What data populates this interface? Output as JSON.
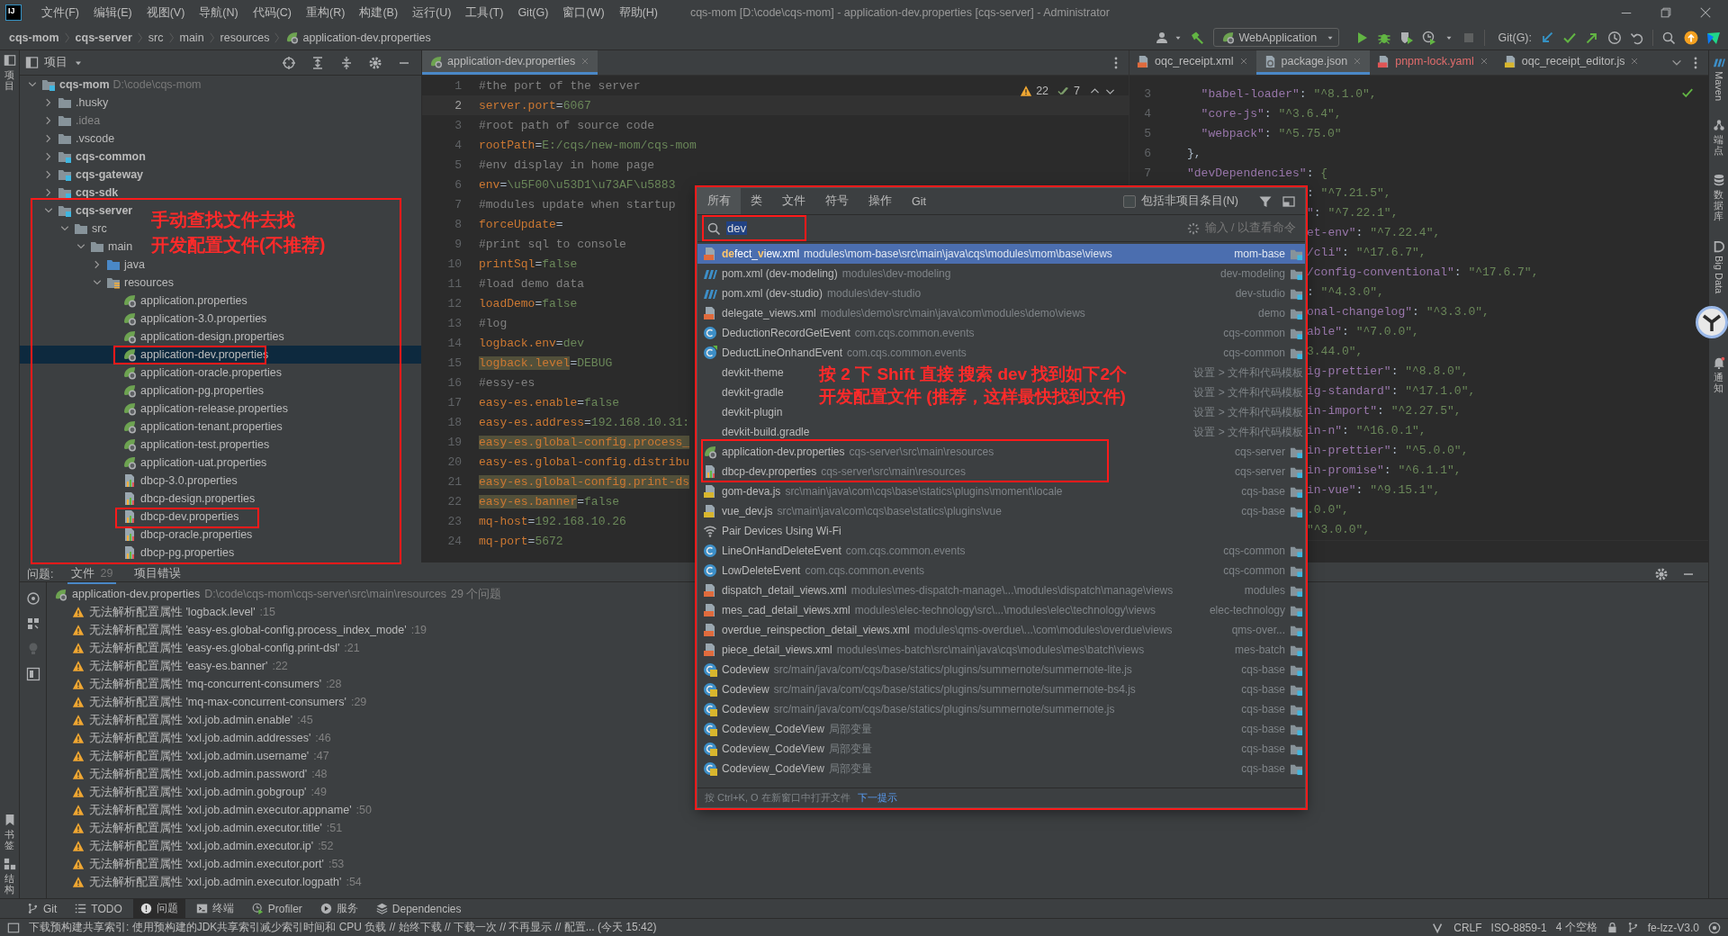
{
  "window": {
    "logo": "IJ",
    "title": "cqs-mom [D:\\code\\cqs-mom] - application-dev.properties [cqs-server] - Administrator"
  },
  "menu": [
    "文件(F)",
    "编辑(E)",
    "视图(V)",
    "导航(N)",
    "代码(C)",
    "重构(R)",
    "构建(B)",
    "运行(U)",
    "工具(T)",
    "Git(G)",
    "窗口(W)",
    "帮助(H)"
  ],
  "breadcrumbs": [
    {
      "label": "cqs-mom",
      "bold": true
    },
    {
      "label": "cqs-server",
      "bold": true
    },
    {
      "label": "src",
      "bold": false
    },
    {
      "label": "main",
      "bold": false
    },
    {
      "label": "resources",
      "bold": false
    },
    {
      "label": "application-dev.properties",
      "bold": false
    }
  ],
  "toolbar": {
    "run_config": "WebApplication",
    "git_label": "Git(G):"
  },
  "left_strip": {
    "top": [
      {
        "label": "项目"
      }
    ],
    "bottom": [
      {
        "label": "书签"
      },
      {
        "label": "结构"
      }
    ]
  },
  "right_strip": [
    {
      "label": "Maven",
      "vertical_latin": true
    },
    {
      "label": "端点",
      "vertical_latin": false
    },
    {
      "label": "数据库",
      "vertical_latin": false
    },
    {
      "label": "Big Data",
      "vertical_latin": true
    },
    {
      "label": "通知",
      "vertical_latin": false
    }
  ],
  "project": {
    "title": "项目",
    "tree": [
      {
        "label": "cqs-mom",
        "path": "D:\\code\\cqs-mom",
        "kind": "module",
        "selected": false,
        "expanded": true,
        "children": [
          {
            "label": ".husky",
            "kind": "folder",
            "selected": false,
            "expanded": false
          },
          {
            "label": ".idea",
            "kind": "excluded",
            "selected": false,
            "expanded": false
          },
          {
            "label": ".vscode",
            "kind": "folder",
            "selected": false,
            "expanded": false
          },
          {
            "label": "cqs-common",
            "kind": "module",
            "selected": false,
            "expanded": false
          },
          {
            "label": "cqs-gateway",
            "kind": "module",
            "selected": false,
            "expanded": false
          },
          {
            "label": "cqs-sdk",
            "kind": "module",
            "selected": false,
            "expanded": false
          },
          {
            "label": "cqs-server",
            "kind": "module",
            "selected": false,
            "expanded": true,
            "children": [
              {
                "label": "src",
                "kind": "folder",
                "selected": false,
                "expanded": true,
                "children": [
                  {
                    "label": "main",
                    "kind": "folder",
                    "selected": false,
                    "expanded": true,
                    "children": [
                      {
                        "label": "java",
                        "kind": "source",
                        "selected": false,
                        "expanded": false
                      },
                      {
                        "label": "resources",
                        "kind": "resources",
                        "selected": false,
                        "expanded": true,
                        "children": [
                          {
                            "label": "application.properties",
                            "kind": "spring",
                            "selected": false
                          },
                          {
                            "label": "application-3.0.properties",
                            "kind": "spring",
                            "selected": false
                          },
                          {
                            "label": "application-design.properties",
                            "kind": "spring",
                            "selected": false
                          },
                          {
                            "label": "application-dev.properties",
                            "kind": "spring",
                            "selected": true
                          },
                          {
                            "label": "application-oracle.properties",
                            "kind": "spring",
                            "selected": false
                          },
                          {
                            "label": "application-pg.properties",
                            "kind": "spring",
                            "selected": false
                          },
                          {
                            "label": "application-release.properties",
                            "kind": "spring",
                            "selected": false
                          },
                          {
                            "label": "application-tenant.properties",
                            "kind": "spring",
                            "selected": false
                          },
                          {
                            "label": "application-test.properties",
                            "kind": "spring",
                            "selected": false
                          },
                          {
                            "label": "application-uat.properties",
                            "kind": "spring",
                            "selected": false
                          },
                          {
                            "label": "dbcp-3.0.properties",
                            "kind": "dbcp",
                            "selected": false
                          },
                          {
                            "label": "dbcp-design.properties",
                            "kind": "dbcp",
                            "selected": false
                          },
                          {
                            "label": "dbcp-dev.properties",
                            "kind": "dbcp",
                            "selected": false
                          },
                          {
                            "label": "dbcp-oracle.properties",
                            "kind": "dbcp",
                            "selected": false
                          },
                          {
                            "label": "dbcp-pg.properties",
                            "kind": "dbcp",
                            "selected": false
                          }
                        ]
                      }
                    ]
                  }
                ]
              }
            ]
          }
        ]
      }
    ]
  },
  "editor": {
    "tab": {
      "label": "application-dev.properties",
      "selected": true
    },
    "warnings": "22",
    "weak_warnings": "7",
    "lines": [
      {
        "number": "1",
        "kind": "comment",
        "text": "#the port of the server",
        "current": false
      },
      {
        "number": "2",
        "kind": "property",
        "text": "server.port=6067",
        "current": true,
        "warn": false
      },
      {
        "number": "3",
        "kind": "comment",
        "text": "#root path of source code",
        "current": false
      },
      {
        "number": "4",
        "kind": "property",
        "text": "rootPath=E:/cqs/new-mom/cqs-mom",
        "current": false,
        "warn": false
      },
      {
        "number": "5",
        "kind": "comment",
        "text": "#env display in home page",
        "current": false
      },
      {
        "number": "6",
        "kind": "property",
        "text": "env=\\u5F00\\u53D1\\u73AF\\u5883",
        "current": false,
        "warn": false
      },
      {
        "number": "7",
        "kind": "comment",
        "text": "#modules update when startup",
        "current": false
      },
      {
        "number": "8",
        "kind": "property",
        "text": "forceUpdate=",
        "current": false,
        "warn": false
      },
      {
        "number": "9",
        "kind": "comment",
        "text": "#print sql to console",
        "current": false
      },
      {
        "number": "10",
        "kind": "property",
        "text": "printSql=false",
        "current": false,
        "warn": false
      },
      {
        "number": "11",
        "kind": "comment",
        "text": "#load demo data",
        "current": false
      },
      {
        "number": "12",
        "kind": "property",
        "text": "loadDemo=false",
        "current": false,
        "warn": false
      },
      {
        "number": "13",
        "kind": "comment",
        "text": "#log",
        "current": false
      },
      {
        "number": "14",
        "kind": "property",
        "text": "logback.env=dev",
        "current": false,
        "warn": false
      },
      {
        "number": "15",
        "kind": "property",
        "text": "logback.level=DEBUG",
        "current": false,
        "warn": true
      },
      {
        "number": "16",
        "kind": "comment",
        "text": "#essy-es",
        "current": false
      },
      {
        "number": "17",
        "kind": "property",
        "text": "easy-es.enable=false",
        "current": false,
        "warn": false
      },
      {
        "number": "18",
        "kind": "property",
        "text": "easy-es.address=192.168.10.31:",
        "current": false,
        "warn": false
      },
      {
        "number": "19",
        "kind": "property",
        "text": "easy-es.global-config.process_",
        "current": false,
        "warn": true
      },
      {
        "number": "20",
        "kind": "property",
        "text": "easy-es.global-config.distribu",
        "current": false,
        "warn": false
      },
      {
        "number": "21",
        "kind": "property",
        "text": "easy-es.global-config.print-ds",
        "current": false,
        "warn": true
      },
      {
        "number": "22",
        "kind": "property",
        "text": "easy-es.banner=false",
        "current": false,
        "warn": true
      },
      {
        "number": "23",
        "kind": "property",
        "text": "mq-host=192.168.10.26",
        "current": false,
        "warn": false
      },
      {
        "number": "24",
        "kind": "property",
        "text": "mq-port=5672",
        "current": false,
        "warn": false
      }
    ]
  },
  "right_editor": {
    "tabs": [
      {
        "label": "oqc_receipt.xml",
        "kind": "xml",
        "selected": false,
        "error": false
      },
      {
        "label": "package.json",
        "kind": "json",
        "selected": true,
        "error": false
      },
      {
        "label": "pnpm-lock.yaml",
        "kind": "yml",
        "selected": false,
        "error": true
      },
      {
        "label": "oqc_receipt_editor.js",
        "kind": "js",
        "selected": false,
        "error": false
      }
    ],
    "lines": [
      {
        "number": "3",
        "text": "  \"babel-loader\": \"^8.1.0\","
      },
      {
        "number": "4",
        "text": "  \"core-js\": \"^3.6.4\","
      },
      {
        "number": "5",
        "text": "  \"webpack\": \"^5.75.0\""
      },
      {
        "number": "6",
        "text": "},"
      },
      {
        "number": "7",
        "text": "\"devDependencies\": {"
      },
      {
        "text": ": \"^7.21.5\","
      },
      {
        "text": "\": \"^7.22.1\","
      },
      {
        "text": "et-env\": \"^7.22.4\","
      },
      {
        "text": "/cli\": \"^17.6.7\","
      },
      {
        "text": "/config-conventional\": \"^17.6.7\","
      },
      {
        "text": ": \"^4.3.0\","
      },
      {
        "text": "onal-changelog\": \"^3.3.0\","
      },
      {
        "text": "able\": \"^7.0.0\","
      },
      {
        "text": "3.44.0\","
      },
      {
        "text": "ig-prettier\": \"^8.8.0\","
      },
      {
        "text": "ig-standard\": \"^17.1.0\","
      },
      {
        "text": "in-import\": \"^2.27.5\","
      },
      {
        "text": "in-n\": \"^16.0.1\","
      },
      {
        "text": "in-prettier\": \"^5.0.0\","
      },
      {
        "text": "in-promise\": \"^6.1.1\","
      },
      {
        "text": "in-vue\": \"^9.15.1\","
      },
      {
        "text": ".0.0\","
      },
      {
        "text": "\"^3.0.0\","
      }
    ]
  },
  "popup": {
    "tabs": [
      {
        "label": "所有",
        "selected": true
      },
      {
        "label": "类",
        "selected": false
      },
      {
        "label": "文件",
        "selected": false
      },
      {
        "label": "符号",
        "selected": false
      },
      {
        "label": "操作",
        "selected": false
      },
      {
        "label": "Git",
        "selected": false
      }
    ],
    "include_checkbox": {
      "label": "包括非项目条目(N)",
      "checked": false
    },
    "search": {
      "value": "dev"
    },
    "hint": "输入 / 以查看命令",
    "results": [
      {
        "kind": "xml",
        "name_parts": [
          {
            "text": "de",
            "match": true
          },
          {
            "text": "fect_",
            "match": false
          },
          {
            "text": "v",
            "match": true
          },
          {
            "text": "iew.xml",
            "match": false
          }
        ],
        "path": "modules\\mom-base\\src\\main\\java\\cqs\\modules\\mom\\base\\views",
        "module": "mom-base",
        "selected": true
      },
      {
        "kind": "pom",
        "name": "pom.xml (dev-modeling)",
        "path": "modules\\dev-modeling",
        "module": "dev-modeling",
        "selected": false
      },
      {
        "kind": "pom",
        "name": "pom.xml (dev-studio)",
        "path": "modules\\dev-studio",
        "module": "dev-studio",
        "selected": false
      },
      {
        "kind": "xml",
        "name": "delegate_views.xml",
        "path": "modules\\demo\\src\\main\\java\\com\\modules\\demo\\views",
        "module": "demo",
        "selected": false
      },
      {
        "kind": "class",
        "name": "DeductionRecordGetEvent",
        "path": "com.cqs.common.events",
        "module": "cqs-common",
        "selected": false
      },
      {
        "kind": "class-marked",
        "name": "DeductLineOnhandEvent",
        "path": "com.cqs.common.events",
        "module": "cqs-common",
        "selected": false
      },
      {
        "kind": "setting",
        "name": "devkit-theme",
        "location": "设置 > 文件和代码模板",
        "selected": false
      },
      {
        "kind": "setting",
        "name": "devkit-gradle",
        "location": "设置 > 文件和代码模板",
        "selected": false
      },
      {
        "kind": "setting",
        "name": "devkit-plugin",
        "location": "设置 > 文件和代码模板",
        "selected": false
      },
      {
        "kind": "setting",
        "name": "devkit-build.gradle",
        "location": "设置 > 文件和代码模板",
        "selected": false
      },
      {
        "kind": "spring",
        "name": "application-dev.properties",
        "path": "cqs-server\\src\\main\\resources",
        "module": "cqs-server",
        "selected": false
      },
      {
        "kind": "dbcp",
        "name": "dbcp-dev.properties",
        "path": "cqs-server\\src\\main\\resources",
        "module": "cqs-server",
        "selected": false
      },
      {
        "kind": "js",
        "name": "gom-deva.js",
        "path": "src\\main\\java\\com\\cqs\\base\\statics\\plugins\\moment\\locale",
        "module": "cqs-base",
        "selected": false
      },
      {
        "kind": "js",
        "name": "vue_dev.js",
        "path": "src\\main\\java\\com\\cqs\\base\\statics\\plugins\\vue",
        "module": "cqs-base",
        "selected": false
      },
      {
        "kind": "action",
        "name": "Pair Devices Using Wi-Fi",
        "selected": false
      },
      {
        "kind": "class",
        "name": "LineOnHandDeleteEvent",
        "path": "com.cqs.common.events",
        "module": "cqs-common",
        "selected": false
      },
      {
        "kind": "class",
        "name": "LowDeleteEvent",
        "path": "com.cqs.common.events",
        "module": "cqs-common",
        "selected": false
      },
      {
        "kind": "xml",
        "name": "dispatch_detail_views.xml",
        "path": "modules\\mes-dispatch-manage\\...\\modules\\dispatch\\manage\\views",
        "module": "modules",
        "selected": false
      },
      {
        "kind": "xml",
        "name": "mes_cad_detail_views.xml",
        "path": "modules\\elec-technology\\src\\...\\modules\\elec\\technology\\views",
        "module": "elec-technology",
        "selected": false
      },
      {
        "kind": "xml",
        "name": "overdue_reinspection_detail_views.xml",
        "path": "modules\\qms-overdue\\...\\com\\modules\\overdue\\views",
        "module": "qms-over...",
        "selected": false
      },
      {
        "kind": "xml",
        "name": "piece_detail_views.xml",
        "path": "modules\\mes-batch\\src\\main\\java\\cqs\\modules\\mes\\batch\\views",
        "module": "mes-batch",
        "selected": false
      },
      {
        "kind": "js-class",
        "name": "Codeview",
        "path": "src/main/java/com/cqs/base/statics/plugins/summernote/summernote-lite.js",
        "module": "cqs-base",
        "selected": false
      },
      {
        "kind": "js-class",
        "name": "Codeview",
        "path": "src/main/java/com/cqs/base/statics/plugins/summernote/summernote-bs4.js",
        "module": "cqs-base",
        "selected": false
      },
      {
        "kind": "js-class",
        "name": "Codeview",
        "path": "src/main/java/com/cqs/base/statics/plugins/summernote/summernote.js",
        "module": "cqs-base",
        "selected": false
      },
      {
        "kind": "js-class",
        "name": "Codeview_CodeView",
        "path": "局部变量",
        "module": "cqs-base",
        "selected": false
      },
      {
        "kind": "js-class",
        "name": "Codeview_CodeView",
        "path": "局部变量",
        "module": "cqs-base",
        "selected": false
      },
      {
        "kind": "js-class",
        "name": "Codeview_CodeView",
        "path": "局部变量",
        "module": "cqs-base",
        "selected": false
      }
    ],
    "footer": {
      "text": "按 Ctrl+K, O 在新窗口中打开文件",
      "link": "下一提示"
    }
  },
  "problems": {
    "title": "问题:",
    "tabs": [
      {
        "label": "文件",
        "count": "29",
        "selected": true
      },
      {
        "label": "项目错误",
        "selected": false
      }
    ],
    "file": {
      "name": "application-dev.properties",
      "path": "D:\\code\\cqs-mom\\cqs-server\\src\\main\\resources",
      "count": "29 个问题"
    },
    "items": [
      {
        "message": "无法解析配置属性 'logback.level'",
        "line": ":15"
      },
      {
        "message": "无法解析配置属性 'easy-es.global-config.process_index_mode'",
        "line": ":19"
      },
      {
        "message": "无法解析配置属性 'easy-es.global-config.print-dsl'",
        "line": ":21"
      },
      {
        "message": "无法解析配置属性 'easy-es.banner'",
        "line": ":22"
      },
      {
        "message": "无法解析配置属性 'mq-concurrent-consumers'",
        "line": ":28"
      },
      {
        "message": "无法解析配置属性 'mq-max-concurrent-consumers'",
        "line": ":29"
      },
      {
        "message": "无法解析配置属性 'xxl.job.admin.enable'",
        "line": ":45"
      },
      {
        "message": "无法解析配置属性 'xxl.job.admin.addresses'",
        "line": ":46"
      },
      {
        "message": "无法解析配置属性 'xxl.job.admin.username'",
        "line": ":47"
      },
      {
        "message": "无法解析配置属性 'xxl.job.admin.password'",
        "line": ":48"
      },
      {
        "message": "无法解析配置属性 'xxl.job.admin.gobgroup'",
        "line": ":49"
      },
      {
        "message": "无法解析配置属性 'xxl.job.admin.executor.appname'",
        "line": ":50"
      },
      {
        "message": "无法解析配置属性 'xxl.job.admin.executor.title'",
        "line": ":51"
      },
      {
        "message": "无法解析配置属性 'xxl.job.admin.executor.ip'",
        "line": ":52"
      },
      {
        "message": "无法解析配置属性 'xxl.job.admin.executor.port'",
        "line": ":53"
      },
      {
        "message": "无法解析配置属性 'xxl.job.admin.executor.logpath'",
        "line": ":54"
      }
    ]
  },
  "tool_tabs": [
    {
      "label": "Git",
      "selected": false
    },
    {
      "label": "TODO",
      "selected": false
    },
    {
      "label": "问题",
      "selected": true
    },
    {
      "label": "终端",
      "selected": false
    },
    {
      "label": "Profiler",
      "selected": false
    },
    {
      "label": "服务",
      "selected": false
    },
    {
      "label": "Dependencies",
      "selected": false
    }
  ],
  "status": {
    "message": "下载预构建共享索引: 使用预构建的JDK共享索引减少索引时间和 CPU 负载 // 始终下载 // 下载一次 // 不再显示 // 配置... (今天 15:42)",
    "items": [
      "CRLF",
      "ISO-8859-1",
      "4 个空格"
    ],
    "branch": "fe-lzz-V3.0"
  },
  "annotations": [
    {
      "kind": "tree-note",
      "lines": [
        "手动查找文件去找",
        "开发配置文件(不推荐)"
      ]
    },
    {
      "kind": "popup-note",
      "lines": [
        "按 2 下 Shift 直接 搜索 dev 找到如下2个",
        "开发配置文件 (推荐，这样最快找到文件)"
      ]
    }
  ]
}
